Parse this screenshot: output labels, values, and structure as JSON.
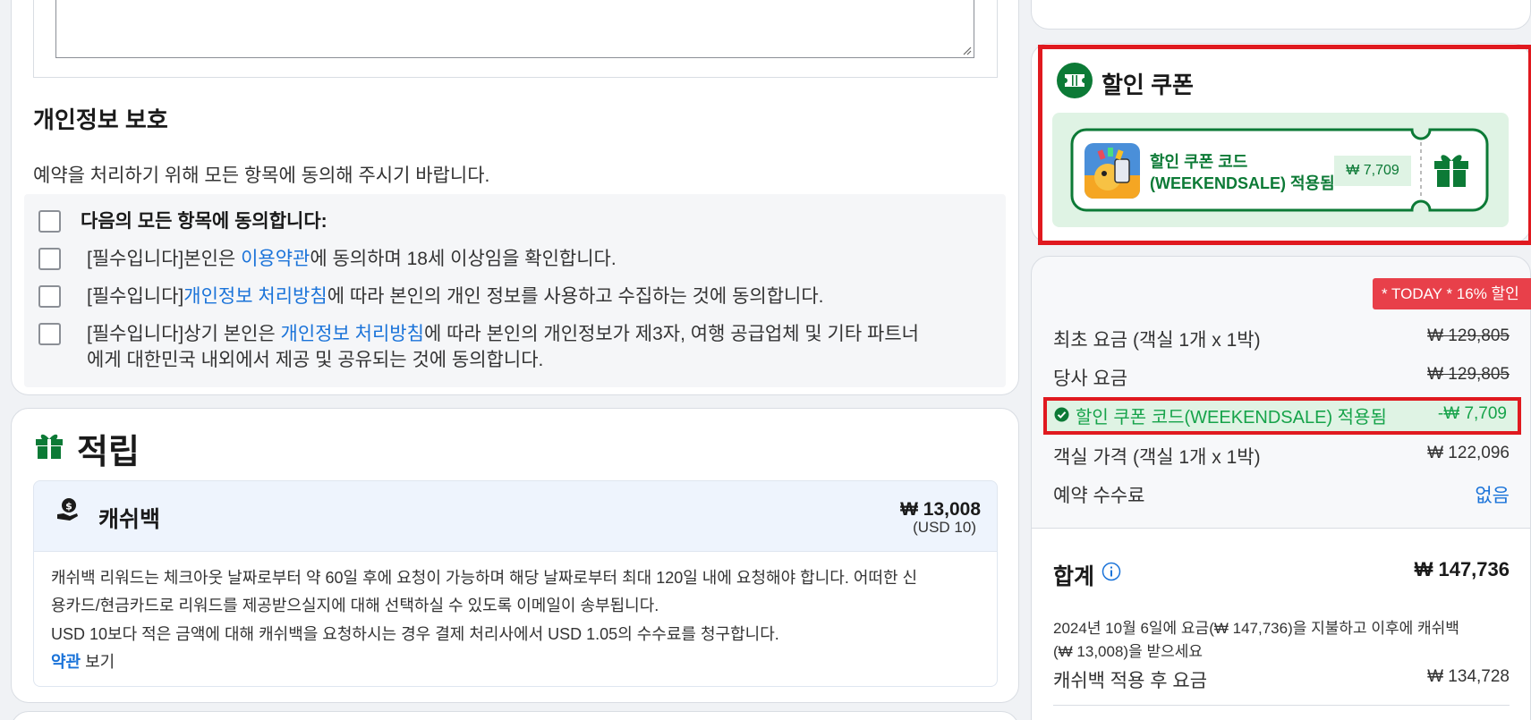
{
  "privacy": {
    "title": "개인정보 보호",
    "description": "예약을 처리하기 위해 모든 항목에 동의해 주시기 바랍니다.",
    "agree_all": "다음의 모든 항목에 동의합니다:",
    "item1": {
      "pre": "[필수입니다]본인은 ",
      "link": "이용약관",
      "post": "에 동의하며 18세 이상임을 확인합니다."
    },
    "item2": {
      "pre": "[필수입니다]",
      "link": "개인정보 처리방침",
      "post": "에 따라 본인의 개인 정보를 사용하고 수집하는 것에 동의합니다."
    },
    "item3": {
      "pre": "[필수입니다]상기 본인은 ",
      "link": "개인정보 처리방침",
      "post": "에 따라 본인의 개인정보가 제3자, 여행 공급업체 및 기타 파트너",
      "line2": "에게 대한민국 내외에서 제공 및 공유되는 것에 동의합니다."
    }
  },
  "reward": {
    "title": "적립",
    "cashback_label": "캐쉬백",
    "cashback_amount": "₩ 13,008",
    "cashback_usd": "(USD 10)",
    "line1": "캐쉬백 리워드는 체크아웃 날짜로부터 약 60일 후에 요청이 가능하며 해당 날짜로부터 최대 120일 내에 요청해야 합니다. 어떠한 신",
    "line2": "용카드/현금카드로 리워드를 제공받으실지에 대해 선택하실 수 있도록 이메일이 송부됩니다.",
    "line3": "USD 10보다 적은 금액에 대해 캐쉬백을 요청하시는 경우 결제 처리사에서 USD 1.05의 수수료를 청구합니다.",
    "terms_link": "약관",
    "terms_suffix": " 보기"
  },
  "coupon": {
    "title": "할인 쿠폰",
    "code_line1": "할인 쿠폰 코드",
    "code_line2": "(WEEKENDSALE) 적용됨",
    "price": "₩ 7,709"
  },
  "pricing": {
    "badge": "* TODAY * 16% 할인",
    "rows": [
      {
        "label": "최초 요금 (객실 1개 x 1박)",
        "value": "₩ 129,805"
      },
      {
        "label": "당사 요금",
        "value": "₩ 129,805"
      }
    ],
    "coupon_row_label": "할인 쿠폰 코드(WEEKENDSALE) 적용됨",
    "coupon_row_value": "-₩ 7,709",
    "room_label": "객실 가격 (객실 1개 x 1박)",
    "room_value": "₩ 122,096",
    "fee_label": "예약 수수료",
    "fee_value": "없음",
    "total_label": "합계",
    "total_value": "₩ 147,736",
    "note_line1": "2024년 10월 6일에 요금(₩ 147,736)을 지불하고 이후에 캐쉬백",
    "note_line2": "(₩ 13,008)을 받으세요",
    "after_label": "캐쉬백 적용 후 요금",
    "after_value": "₩ 134,728"
  },
  "colors": {
    "link": "#1a73d9",
    "green": "#0c7a36",
    "highlight": "#e0191f",
    "badge": "#e8404a"
  }
}
